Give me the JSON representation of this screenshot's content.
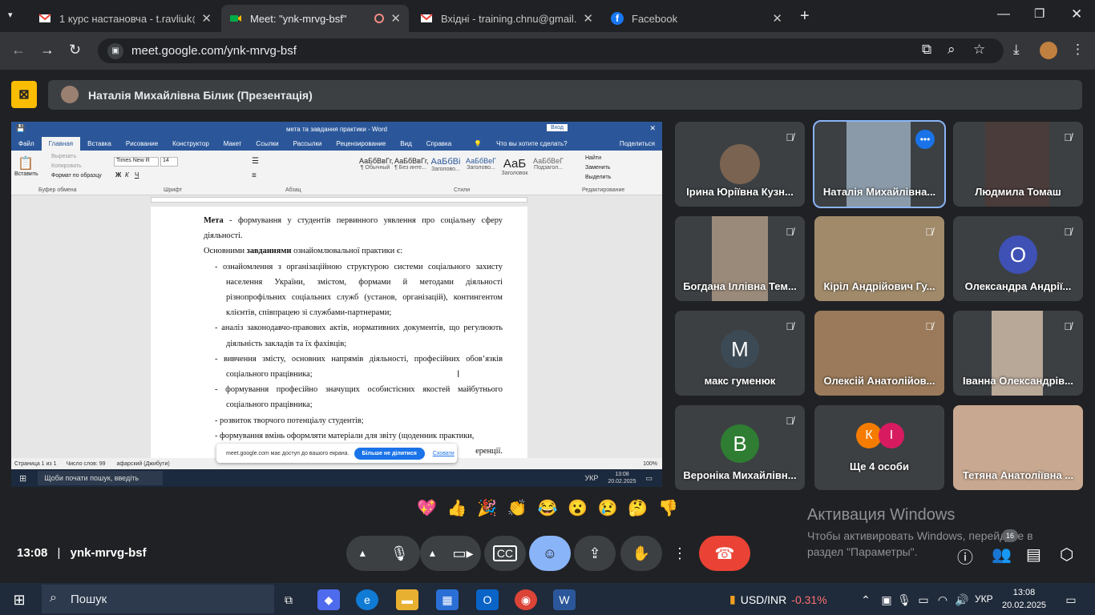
{
  "browser": {
    "tabs": [
      {
        "title": "1 курс настановча - t.ravliuk@",
        "icon": "gmail-icon"
      },
      {
        "title": "Meet: \"ynk-mrvg-bsf\"",
        "icon": "meet-icon",
        "active": true
      },
      {
        "title": "Вхідні - training.chnu@gmail.co",
        "icon": "gmail-icon"
      },
      {
        "title": "Facebook",
        "icon": "facebook-icon"
      }
    ],
    "url": "meet.google.com/ynk-mrvg-bsf"
  },
  "presentation": {
    "banner": "Наталія Михайлівна Білик (Презентація)"
  },
  "word": {
    "title": "мета та завдання практики  -  Word",
    "signin": "Вход",
    "tell_me": "Что вы хотите сделать?",
    "share": "Поделиться",
    "tabs": [
      "Файл",
      "Главная",
      "Вставка",
      "Рисование",
      "Конструктор",
      "Макет",
      "Ссылки",
      "Рассылки",
      "Рецензирование",
      "Вид",
      "Справка"
    ],
    "groups": [
      "Буфер обмена",
      "Шрифт",
      "Абзац",
      "Стили",
      "Редактирование"
    ],
    "font": "Times New R",
    "font_size": "14",
    "paste": "Вставить",
    "cut": "Вырезать",
    "copy": "Копировать",
    "format_painter": "Формат по образцу",
    "styles": [
      {
        "sample": "АаБбВвГг,",
        "label": "¶ Обычный"
      },
      {
        "sample": "АаБбВвГг,",
        "label": "¶ Без инте..."
      },
      {
        "sample": "АаБбВі",
        "label": "Заголово..."
      },
      {
        "sample": "АаБбВеГ",
        "label": "Заголово..."
      },
      {
        "sample": "АаБ",
        "label": "Заголовок"
      },
      {
        "sample": "АаБбВеГ",
        "label": "Подзагол..."
      }
    ],
    "find": "Найти",
    "replace": "Заменить",
    "select": "Выделить",
    "doc": {
      "p1_bold": "Мета",
      "p1_rest": " - формування у студентів первинного уявлення про соціальну сферу діяльності.",
      "p2_a": "Основними ",
      "p2_bold": "завданнями",
      "p2_b": " ознайомлювальної практики є:",
      "items": [
        "-   ознайомлення з організаційною структурою системи соціального захисту населення України, змістом, формами й методами діяльності різнопрофільних соціальних служб (установ, організацій), контингентом клієнтів, співпрацею зі службами-партнерами;",
        "-   аналіз законодавчо-правових актів, нормативних документів, що регулюють діяльність закладів та їх фахівців;",
        "-   вивчення змісту, основних напрямів діяльності, професійних обов’язків соціального працівника;",
        "-   формування професійно значущих особистісних якостей майбутнього соціального працівника;",
        "-   розвиток творчого потенціалу студентів;",
        "-   формування вмінь оформляти матеріали для звіту (щоденник практики,"
      ],
      "tail": "еренції."
    },
    "status": {
      "page": "Страница 1 из 1",
      "words": "Число слов: 99",
      "lang": "афарский (Джибути)",
      "zoom": "100%"
    },
    "share_bar": {
      "text": "meet.google.com має доступ до вашого екрана.",
      "stop": "Більше не ділитися",
      "hide": "Сховати"
    },
    "inner_taskbar": {
      "search": "Щоби почати пошук, введіть",
      "lang": "УКР",
      "time": "13:08",
      "date": "20.02.2025"
    }
  },
  "participants": [
    {
      "name": "Ірина Юріївна Кузн...",
      "muted": true,
      "type": "photo",
      "color": "#7a6350"
    },
    {
      "name": "Наталія Михайлівна...",
      "muted": false,
      "type": "photo",
      "color": "#8a9aa8",
      "speaking": true
    },
    {
      "name": "Людмила Томаш",
      "muted": true,
      "type": "photo",
      "color": "#4a3c3a"
    },
    {
      "name": "Богдана Іллівна Тем...",
      "muted": true,
      "type": "photo",
      "color": "#9a8a7a"
    },
    {
      "name": "Кіріл Андрійович Гу...",
      "muted": true,
      "type": "photo",
      "color": "#a08a6a"
    },
    {
      "name": "Олександра Андрії...",
      "muted": true,
      "type": "avatar",
      "letter": "О",
      "color": "#3f51b5"
    },
    {
      "name": "макс гуменюк",
      "muted": true,
      "type": "avatar",
      "letter": "М",
      "color": "#3c4a55"
    },
    {
      "name": "Олексій Анатолійов...",
      "muted": true,
      "type": "photo",
      "color": "#9a7a5a"
    },
    {
      "name": "Іванна Олександрів...",
      "muted": true,
      "type": "photo",
      "color": "#b8a898"
    },
    {
      "name": "Вероніка Михайлівн...",
      "muted": true,
      "type": "avatar",
      "letter": "В",
      "color": "#2e7d32"
    },
    {
      "name": "Ще 4 особи",
      "muted": false,
      "type": "more",
      "letters": [
        "К",
        "І"
      ],
      "colors": [
        "#f57c00",
        "#d81b60"
      ]
    },
    {
      "name": "Тетяна Анатоліївна ...",
      "muted": false,
      "type": "photo",
      "color": "#c8a890"
    }
  ],
  "reactions": [
    "💖",
    "👍",
    "🎉",
    "👏",
    "😂",
    "😮",
    "😢",
    "🤔",
    "👎"
  ],
  "meeting": {
    "time": "13:08",
    "separator": "|",
    "code": "ynk-mrvg-bsf",
    "people_count": "16"
  },
  "activate": {
    "title": "Активация Windows",
    "body": "Чтобы активировать Windows, перейдите в раздел \"Параметры\"."
  },
  "taskbar": {
    "search": "Пошук",
    "ticker": "USD/INR",
    "change": "-0.31%",
    "lang": "УКР",
    "time": "13:08",
    "date": "20.02.2025"
  },
  "colors": {
    "accent": "#8ab4f8",
    "end_call": "#ea4335",
    "word_blue": "#2b579a",
    "stop_share": "#fbbc04"
  }
}
